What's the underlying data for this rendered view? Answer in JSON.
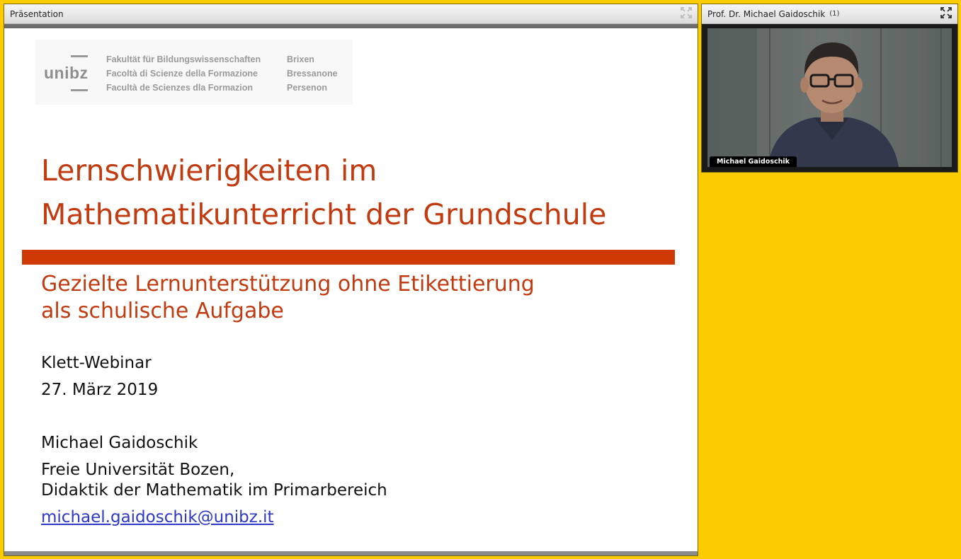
{
  "presentation_pod": {
    "title": "Präsentation",
    "fullscreen_icon": "fullscreen-icon"
  },
  "slide": {
    "logo": {
      "wordmark": "unibz",
      "faculty_lines": [
        "Fakultät für Bildungswissenschaften",
        "Facoltà di Scienze della Formazione",
        "Facultà de Scienzes dla Formazion"
      ],
      "city_lines": [
        "Brixen",
        "Bressanone",
        "Persenon"
      ]
    },
    "title_lines": [
      "Lernschwierigkeiten im",
      "Mathematikunterricht der Grundschule"
    ],
    "subtitle_lines": [
      "Gezielte Lernunterstützung ohne Etikettierung",
      "als schulische Aufgabe"
    ],
    "event": "Klett-Webinar",
    "date": "27. März 2019",
    "author": "Michael Gaidoschik",
    "affiliation_lines": [
      "Freie Universität Bozen,",
      "Didaktik der Mathematik im Primarbereich"
    ],
    "email": "michael.gaidoschik@unibz.it",
    "colors": {
      "title": "#c23a0f",
      "rule": "#cf3a04",
      "link": "#2d37c8"
    }
  },
  "camera_pod": {
    "title": "Prof. Dr. Michael Gaidoschik",
    "count": "(1)",
    "name_tag": "Michael Gaidoschik",
    "fullscreen_icon": "fullscreen-icon"
  },
  "colors": {
    "background": "#fccb00"
  }
}
